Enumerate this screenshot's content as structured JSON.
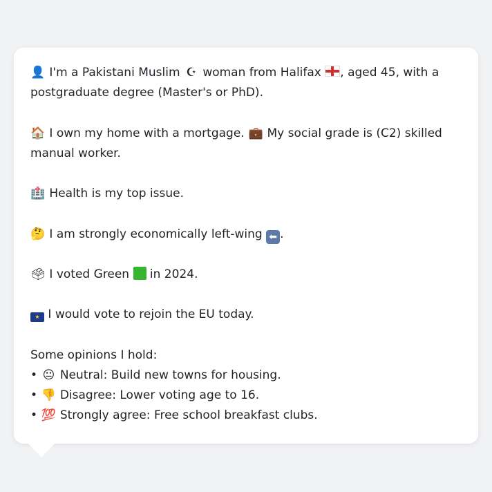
{
  "profile": {
    "line1a": "I'm a Pakistani Muslim",
    "line1b": "woman from Halifax",
    "line1c": ", aged 45, with a",
    "line2": "postgraduate degree (Master's or PhD).",
    "home_a": "I own my home with a mortgage.",
    "home_b": "My social grade is (C2) skilled",
    "home_c": "manual worker.",
    "health": "Health is my top issue.",
    "econ_a": "I am strongly economically left-wing",
    "econ_b": ".",
    "vote_a": "I voted Green",
    "vote_b": "in 2024.",
    "eu": "I would vote to rejoin the EU today."
  },
  "opinions": {
    "heading": "Some opinions I hold:",
    "items": [
      {
        "bullet": "•",
        "text": "Neutral: Build new towns for housing."
      },
      {
        "bullet": "•",
        "text": "Disagree: Lower voting age to 16."
      },
      {
        "bullet": "•",
        "text": "Strongly agree: Free school breakfast clubs."
      }
    ]
  },
  "icons": {
    "person": "👤",
    "crescent": "☪",
    "house": "🏠",
    "briefcase": "💼",
    "hospital": "🏥",
    "thinking": "🤔",
    "left_arrow": "⬅",
    "ballot": "🗳",
    "eu_stars": "★",
    "neutral_face": "😐",
    "thumbs_down": "👎",
    "hundred": "💯"
  },
  "colors": {
    "background": "#f1f2f4",
    "bubble": "#ffffff",
    "text": "#1f2227",
    "green": "#36b52f",
    "eu_blue": "#1e3a8a"
  }
}
